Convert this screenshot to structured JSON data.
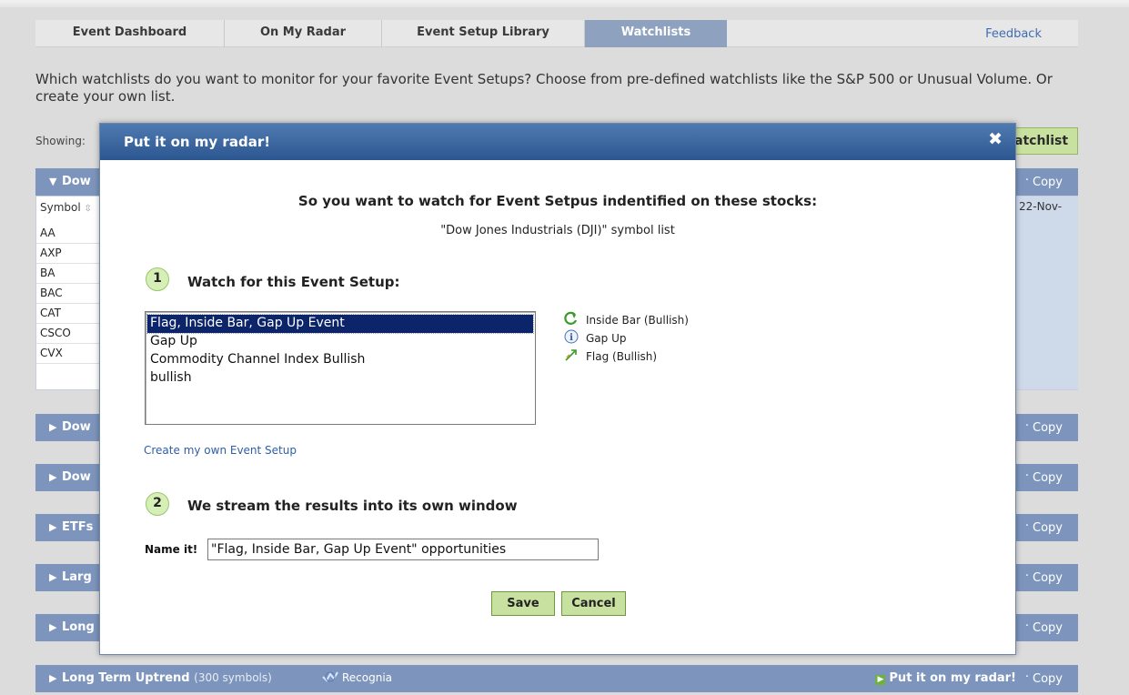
{
  "nav": {
    "tabs": [
      {
        "label": "Event Dashboard",
        "active": false
      },
      {
        "label": "On My Radar",
        "active": false
      },
      {
        "label": "Event Setup Library",
        "active": false
      },
      {
        "label": "Watchlists",
        "active": true
      }
    ],
    "feedback": "Feedback"
  },
  "intro": "Which watchlists do you want to monitor for your favorite Event Setups? Choose from pre-defined watchlists like the S&P 500 or Unusual Volume. Or create your own list.",
  "showing_label": "Showing:",
  "add_watchlist_label": "atchlist",
  "panels": {
    "dow_expanded_title": "Dow",
    "symbol_header": "Symbol",
    "date_header": "22-Nov-",
    "symbols": [
      "AA",
      "AXP",
      "BA",
      "BAC",
      "CAT",
      "CSCO",
      "CVX"
    ],
    "collapsed_titles": [
      "Dow",
      "Dow",
      "ETFs",
      "Larg",
      "Long"
    ],
    "copy_label": "Copy",
    "last": {
      "title": "Long Term Uptrend",
      "count": "(300 symbols)",
      "brand": "Recognia",
      "radar": "Put it on my radar!",
      "copy": "Copy"
    }
  },
  "modal": {
    "title": "Put it on my radar!",
    "heading": "So you want to watch for Event Setpus indentified on these stocks:",
    "subheading": "\"Dow Jones Industrials (DJI)\" symbol list",
    "step1": {
      "number": "1",
      "title": "Watch for this Event Setup:"
    },
    "setups": [
      "Flag, Inside Bar, Gap Up Event",
      "Gap Up",
      "Commodity Channel Index Bullish",
      "bullish"
    ],
    "selected_setup": "Flag, Inside Bar, Gap Up Event",
    "legend": [
      {
        "icon": "inside-bar-icon",
        "label": "Inside Bar (Bullish)"
      },
      {
        "icon": "info-icon",
        "label": "Gap Up"
      },
      {
        "icon": "flag-icon",
        "label": "Flag (Bullish)"
      }
    ],
    "create_link": "Create my own Event Setup",
    "step2": {
      "number": "2",
      "title": "We stream the results into its own window"
    },
    "name_label": "Name it!",
    "name_value": "\"Flag, Inside Bar, Gap Up Event\" opportunities",
    "save": "Save",
    "cancel": "Cancel"
  },
  "colors": {
    "panel_bar": "#7d95bd",
    "modal_header": "#2c5690",
    "button_green": "#c9e1a0",
    "active_tab": "#8ea2c0",
    "selected_option": "#0b246a"
  }
}
